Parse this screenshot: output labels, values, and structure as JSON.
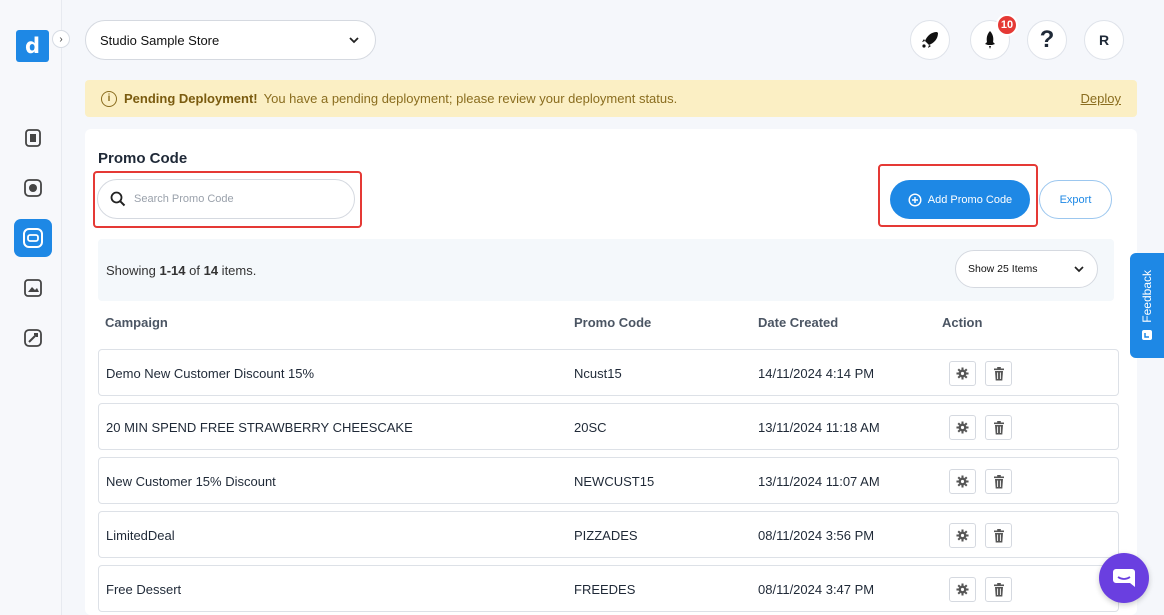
{
  "sidebar": {
    "logo_letter": "d",
    "expand_glyph": "›",
    "items": [
      {
        "icon": "receipt-icon"
      },
      {
        "icon": "settings-icon"
      },
      {
        "icon": "promo-code-icon",
        "active": true
      },
      {
        "icon": "image-icon"
      },
      {
        "icon": "rocket-link-icon"
      }
    ]
  },
  "header": {
    "store_name": "Studio Sample Store",
    "notification_count": "10",
    "help_label": "?",
    "avatar_initial": "R"
  },
  "banner": {
    "title": "Pending Deployment!",
    "message": "You have a pending deployment; please review your deployment status.",
    "action": "Deploy"
  },
  "page": {
    "title": "Promo Code",
    "search_placeholder": "Search Promo Code",
    "add_button": "Add Promo Code",
    "export_button": "Export",
    "showing_prefix": "Showing ",
    "showing_range": "1-14",
    "showing_of": " of ",
    "showing_total": "14",
    "showing_suffix": " items.",
    "page_size": "Show 25 Items"
  },
  "table": {
    "columns": [
      "Campaign",
      "Promo Code",
      "Date Created",
      "Action"
    ],
    "rows": [
      {
        "campaign": "Demo New Customer Discount 15%",
        "code": "Ncust15",
        "date": "14/11/2024 4:14 PM"
      },
      {
        "campaign": "20 MIN SPEND FREE STRAWBERRY CHEESCAKE",
        "code": "20SC",
        "date": "13/11/2024 11:18 AM"
      },
      {
        "campaign": "New Customer 15% Discount",
        "code": "NEWCUST15",
        "date": "13/11/2024 11:07 AM"
      },
      {
        "campaign": "LimitedDeal",
        "code": "PIZZADES",
        "date": "08/11/2024 3:56 PM"
      },
      {
        "campaign": "Free Dessert",
        "code": "FREEDES",
        "date": "08/11/2024 3:47 PM"
      }
    ]
  },
  "feedback_label": "Feedback",
  "colors": {
    "primary": "#1e88e5",
    "banner_bg": "#fbefc4",
    "highlight": "#e53935",
    "chat": "#6a3fe0"
  }
}
